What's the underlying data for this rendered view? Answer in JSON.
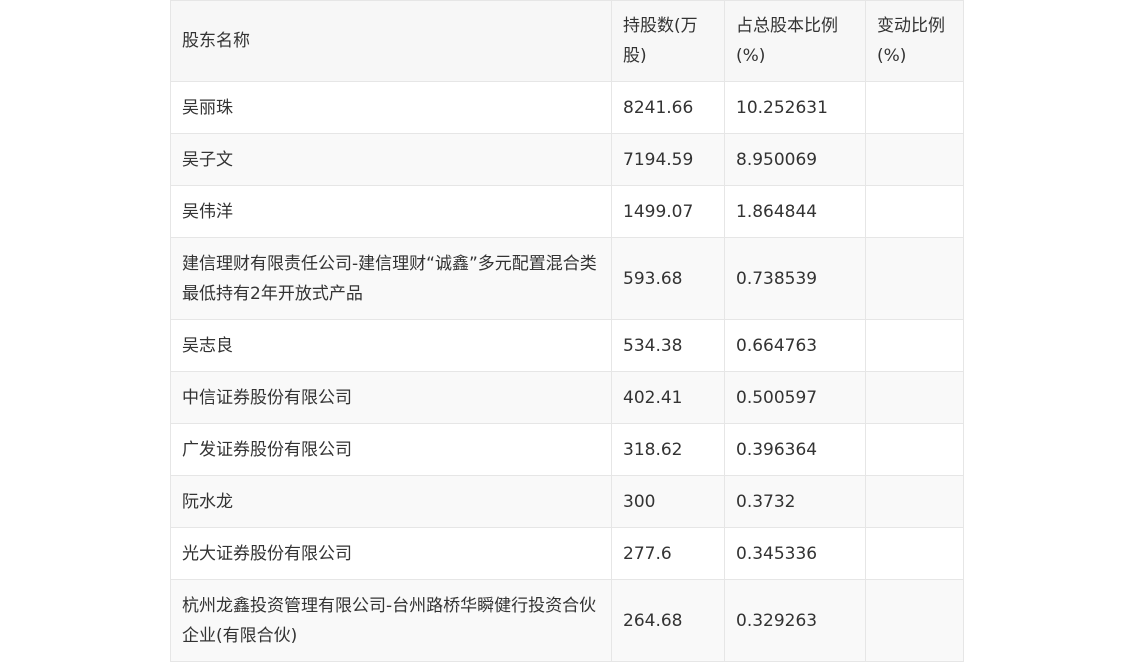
{
  "table": {
    "headers": [
      "股东名称",
      "持股数(万股)",
      "占总股本比例(%)",
      "变动比例(%)"
    ],
    "rows": [
      [
        "吴丽珠",
        "8241.66",
        "10.252631",
        ""
      ],
      [
        "吴子文",
        "7194.59",
        "8.950069",
        ""
      ],
      [
        "吴伟洋",
        "1499.07",
        "1.864844",
        ""
      ],
      [
        "建信理财有限责任公司-建信理财“诚鑫”多元配置混合类最低持有2年开放式产品",
        "593.68",
        "0.738539",
        ""
      ],
      [
        "吴志良",
        "534.38",
        "0.664763",
        ""
      ],
      [
        "中信证券股份有限公司",
        "402.41",
        "0.500597",
        ""
      ],
      [
        "广发证券股份有限公司",
        "318.62",
        "0.396364",
        ""
      ],
      [
        "阮水龙",
        "300",
        "0.3732",
        ""
      ],
      [
        "光大证券股份有限公司",
        "277.6",
        "0.345336",
        ""
      ],
      [
        "杭州龙鑫投资管理有限公司-台州路桥华瞬健行投资合伙企业(有限合伙)",
        "264.68",
        "0.329263",
        ""
      ]
    ]
  }
}
